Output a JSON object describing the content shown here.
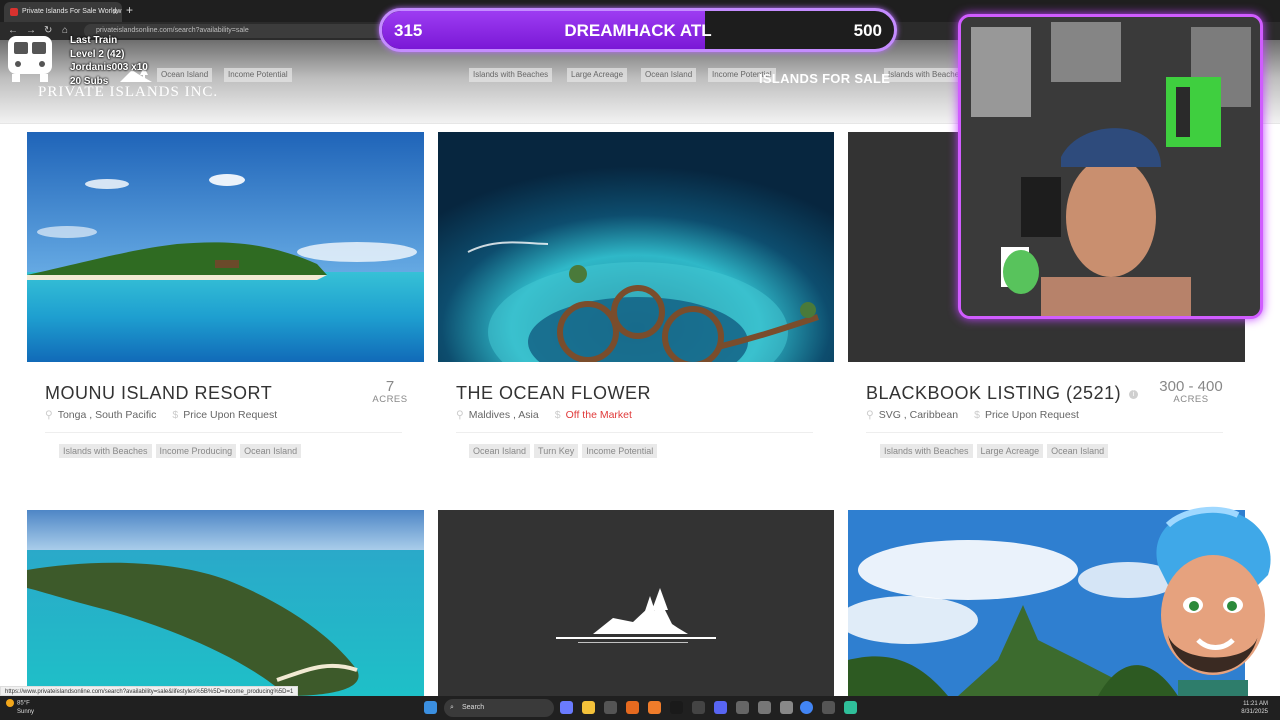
{
  "browser": {
    "tab_title": "Private Islands For Sale Worldw",
    "url": "privateislandsonline.com/search?availability=sale"
  },
  "site_header": {
    "logo_text": "PRIVATE ISLANDS INC.",
    "nav_link": "ISLANDS FOR SALE",
    "top_tags_left": [
      "Ocean Island",
      "Income Potential"
    ],
    "top_tags_mid": [
      "Islands with Beaches",
      "Large Acreage",
      "Ocean Island",
      "Income Potential"
    ],
    "top_tags_right": [
      "Islands with Beaches"
    ]
  },
  "stream": {
    "train_label": "Last Train",
    "level": "Level 2  (42)",
    "last_sub": "Jordanis003 x10",
    "subs": "20 Subs",
    "goal_current": "315",
    "goal_title": "DREAMHACK ATL",
    "goal_target": "500",
    "goal_progress": 0.63
  },
  "listings": [
    {
      "title": "MOUNU ISLAND RESORT",
      "location": "Tonga , South Pacific",
      "price": "Price Upon Request",
      "acres_value": "7",
      "acres_label": "ACRES",
      "tags": [
        "Islands with Beaches",
        "Income Producing",
        "Ocean Island"
      ]
    },
    {
      "title": "THE OCEAN FLOWER",
      "location": "Maldives , Asia",
      "price": "Off the Market",
      "tags": [
        "Ocean Island",
        "Turn Key",
        "Income Potential"
      ]
    },
    {
      "title": "BLACKBOOK LISTING (2521)",
      "location": "SVG , Caribbean",
      "price": "Price Upon Request",
      "acres_value": "300 - 400",
      "acres_label": "ACRES",
      "tags": [
        "Islands with Beaches",
        "Large Acreage",
        "Ocean Island"
      ]
    }
  ],
  "status_link": "https://www.privateislandsonline.com/search?availability=sale&lifestyles%5B%5D=income_producing%5D=1",
  "taskbar": {
    "weather_temp": "85°F",
    "weather_desc": "Sunny",
    "search_label": "Search",
    "time": "11:21 AM",
    "date": "8/31/2025"
  },
  "colors": {
    "goal_border": "#c48cff",
    "goal_fill": "#8a22e6",
    "off_market": "#e03a3a",
    "webcam_border": "#d05cff"
  }
}
